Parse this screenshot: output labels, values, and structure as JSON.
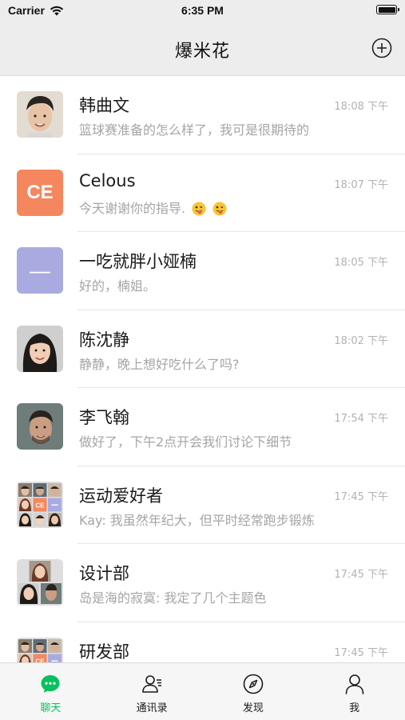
{
  "status_bar": {
    "carrier": "Carrier",
    "time": "6:35 PM"
  },
  "nav": {
    "title": "爆米花",
    "add_icon": "add-circle-icon"
  },
  "chats": [
    {
      "name": "韩曲文",
      "time": "18:08 下午",
      "preview": "篮球赛准备的怎么样了，我可是很期待的",
      "avatar_type": "photo",
      "avatar_desc": "young man photo"
    },
    {
      "name": "Celous",
      "time": "18:07 下午",
      "preview": "今天谢谢你的指导.",
      "preview_emoji_count": 2,
      "avatar_type": "text",
      "avatar_text": "CE",
      "avatar_color": "#f5875e"
    },
    {
      "name": "一吃就胖小娅楠",
      "time": "18:05 下午",
      "preview": "好的，楠姐。",
      "avatar_type": "text",
      "avatar_text": "—",
      "avatar_color": "#a9abe0"
    },
    {
      "name": "陈沈静",
      "time": "18:02 下午",
      "preview": "静静，晚上想好吃什么了吗?",
      "avatar_type": "photo",
      "avatar_desc": "young woman photo"
    },
    {
      "name": "李飞翰",
      "time": "17:54 下午",
      "preview": "做好了，下午2点开会我们讨论下细节",
      "avatar_type": "photo",
      "avatar_desc": "man photo"
    },
    {
      "name": "运动爱好者",
      "time": "17:45 下午",
      "preview": "Kay: 我虽然年纪大，但平时经常跑步锻炼",
      "avatar_type": "group9"
    },
    {
      "name": "设计部",
      "time": "17:45 下午",
      "preview": "岛是海的寂寞: 我定了几个主题色",
      "avatar_type": "group3"
    },
    {
      "name": "研发部",
      "time": "17:45 下午",
      "preview": "",
      "avatar_type": "group9"
    }
  ],
  "tabs": [
    {
      "label": "聊天",
      "icon": "chat-bubble-icon",
      "active": true
    },
    {
      "label": "通讯录",
      "icon": "contacts-icon",
      "active": false
    },
    {
      "label": "发现",
      "icon": "compass-icon",
      "active": false
    },
    {
      "label": "我",
      "icon": "person-icon",
      "active": false
    }
  ],
  "colors": {
    "accent": "#07c160",
    "nav_bg": "#ededed",
    "time_text": "#b2b2b2",
    "preview_text": "#a5a5a5"
  }
}
